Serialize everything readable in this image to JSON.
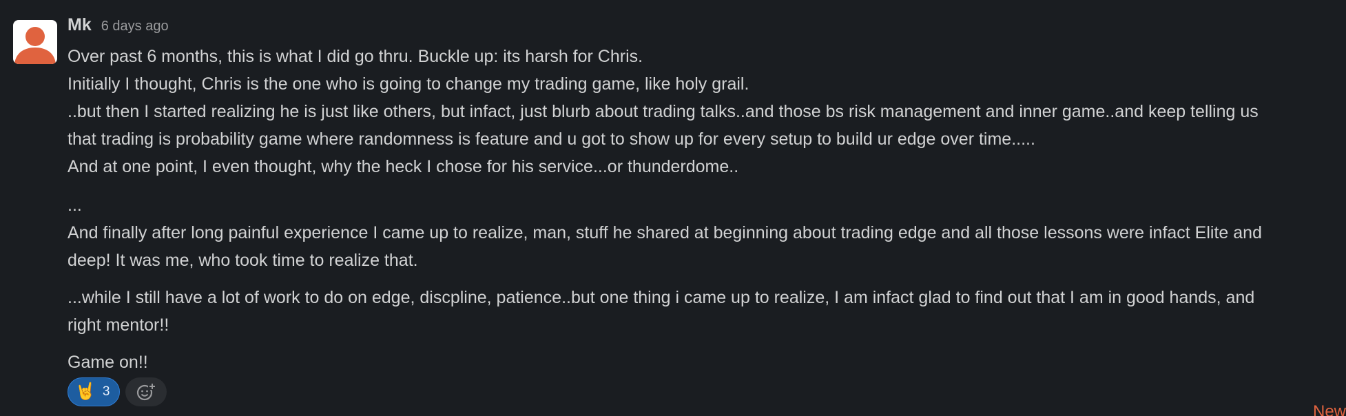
{
  "message": {
    "author": "Mk",
    "timestamp": "6 days ago",
    "lines": [
      "Over past 6 months, this is what I did go thru. Buckle up: its harsh for Chris.",
      "Initially I thought, Chris is the one who is going to change my trading game, like holy grail.",
      "..but then I started realizing he is just like others, but infact, just blurb about trading talks..and those bs risk management and inner game..and keep telling us",
      "that trading is probability game where randomness is feature and u got to show up for every setup to build ur edge over time.....",
      "And at one point, I even thought, why the heck I chose for his service...or thunderdome..",
      "...",
      "And finally after long painful experience I came up to realize, man, stuff he shared at beginning about trading edge and all those lessons were infact Elite and",
      "deep! It was me, who took time to realize that.",
      "...while I still have a lot of work to do on  edge, discpline, patience..but one thing i came up to realize, I am infact glad to find out that I am in good hands, and",
      "right mentor!!",
      "Game on!!"
    ]
  },
  "reactions": [
    {
      "emoji": "🤘",
      "count": "3"
    }
  ],
  "add_reaction_icon": "add-emoji-icon",
  "new_marker": "New",
  "colors": {
    "background": "#1a1d21",
    "text": "#d1d2d3",
    "timestamp": "#9a9b9d",
    "reaction_bg": "#1d5da0",
    "avatar_accent": "#e0633f",
    "new_marker": "#e0633f"
  }
}
